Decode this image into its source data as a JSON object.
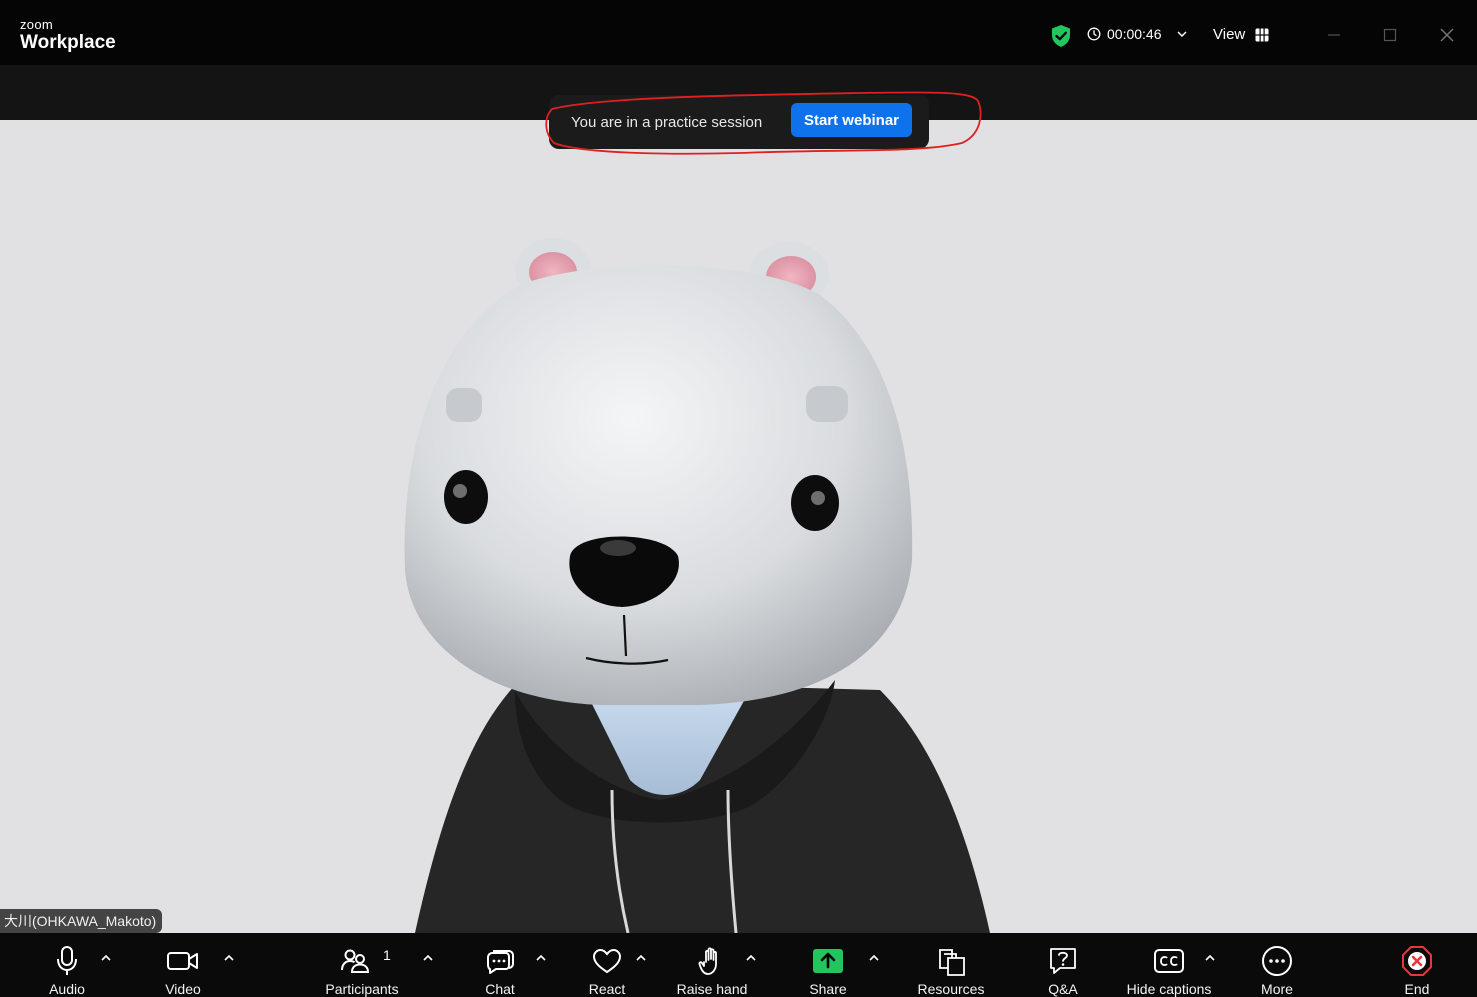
{
  "app": {
    "brand_small": "zoom",
    "brand_large": "Workplace",
    "timer": "00:00:46",
    "view_label": "View"
  },
  "banner": {
    "text": "You are in a practice session",
    "button_label": "Start webinar"
  },
  "participant": {
    "name": "大川(OHKAWA_Makoto)"
  },
  "toolbar": {
    "audio": "Audio",
    "video": "Video",
    "participants": "Participants",
    "participants_count": "1",
    "chat": "Chat",
    "react": "React",
    "raise_hand": "Raise hand",
    "share": "Share",
    "resources": "Resources",
    "qa": "Q&A",
    "captions": "Hide captions",
    "more": "More",
    "end": "End"
  },
  "colors": {
    "accent": "#0e72ed",
    "share": "#22c55e",
    "end": "#e5383b",
    "shield": "#22c55e"
  }
}
